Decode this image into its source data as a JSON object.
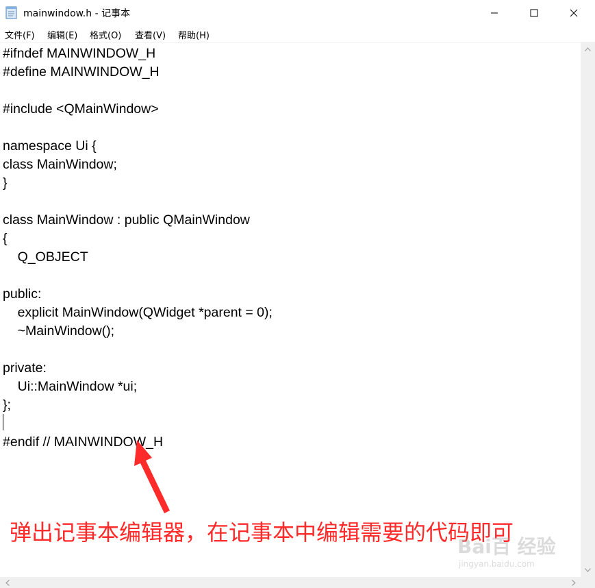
{
  "window": {
    "title": "mainwindow.h - 记事本",
    "icon": "notepad-icon"
  },
  "menu": {
    "items": [
      {
        "label": "文件(F)"
      },
      {
        "label": "编辑(E)"
      },
      {
        "label": "格式(O)"
      },
      {
        "label": "查看(V)"
      },
      {
        "label": "帮助(H)"
      }
    ]
  },
  "editor": {
    "content": "#ifndef MAINWINDOW_H\n#define MAINWINDOW_H\n\n#include <QMainWindow>\n\nnamespace Ui {\nclass MainWindow;\n}\n\nclass MainWindow : public QMainWindow\n{\n    Q_OBJECT\n\npublic:\n    explicit MainWindow(QWidget *parent = 0);\n    ~MainWindow();\n\nprivate:\n    Ui::MainWindow *ui;\n};\n\n#endif // MAINWINDOW_H"
  },
  "annotation": {
    "text": "弹出记事本编辑器，在记事本中编辑需要的代码即可",
    "color": "#ff2a2a"
  },
  "watermark": {
    "logo": "Bai百 经验",
    "url": "jingyan.baidu.com"
  }
}
